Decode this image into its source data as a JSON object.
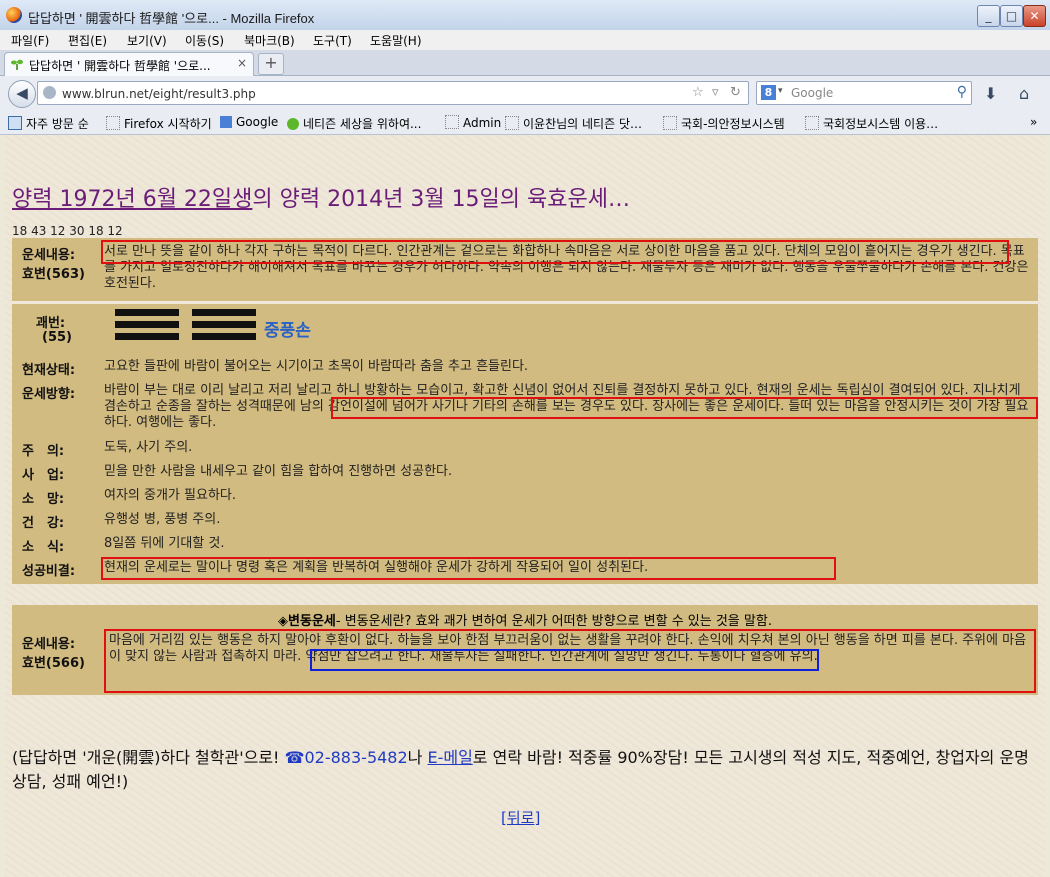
{
  "window": {
    "title": "답답하면 ' 開雲하다 哲學館 '으로... - Mozilla Firefox",
    "min": "_",
    "max": "□",
    "close": "✕"
  },
  "menu": [
    "파일(F)",
    "편집(E)",
    "보기(V)",
    "이동(S)",
    "북마크(B)",
    "도구(T)",
    "도움말(H)"
  ],
  "tab": {
    "label": "답답하면 ' 開雲하다 哲學館 '으로...",
    "close": "×",
    "new": "+"
  },
  "nav": {
    "url": "www.blrun.net/eight/result3.php",
    "search_placeholder": "Google",
    "search_engine": "8"
  },
  "bookmarks": [
    "자주 방문 순",
    "Firefox 시작하기",
    "Google",
    "네티즌 세상을 위하여...",
    "Admin",
    "이윤찬님의 네티즌 닷…",
    "국회-의안정보시스템",
    "국회정보시스템 이용…"
  ],
  "page": {
    "heading_link": "양력 1972년 6월 22일생",
    "heading_rest": "의 양력 2014년 3월 15일의 육효운세…",
    "codes": "18 43 12 30 18 12",
    "fortune": {
      "label1": "운세내용:",
      "label2": "효변(563)",
      "text": "서로 만나 뜻을 같이 하나 각자 구하는 목적이 다르다. 인간관계는 겉으로는 화합하나 속마음은 서로 상이한 마음을 품고 있다. 단체의 모임이 흩어지는 경우가 생긴다. 목표를 가지고 일로정진하다가 해이해져서 목표를 바꾸는 경우가 허다하다. 약속의 이행은 되지 않는다. 재물투자 등은 재미가 없다. 행동을 우물쭈물하다가 손해를 본다. 건강은 호전된다."
    },
    "hexagram": {
      "label1": "괘번:",
      "label2": "(55)",
      "name": "중풍손"
    },
    "details": [
      {
        "label": "현재상태:",
        "text": "고요한 들판에 바람이 불어오는 시기이고 초목이 바람따라 춤을 추고 흔들린다."
      },
      {
        "label": "운세방향:",
        "text": "바람이 부는 대로 이리 날리고 저리 날리고 하니 방황하는 모습이고, 확고한 신념이 없어서 진퇴를 결정하지 못하고 있다. 현재의 운세는 독립심이 결여되어 있다. 지나치게 겸손하고 순종을 잘하는 성격때문에 남의 감언이설에 넘어가 사기나 기타의 손해를 보는 경우도 있다. 장사에는 좋은 운세이다. 들떠 있는 마음을 안정시키는 것이 가장 필요하다. 여행에는 좋다."
      },
      {
        "label": "주　의:",
        "text": "도둑, 사기 주의."
      },
      {
        "label": "사　업:",
        "text": "믿을 만한 사람을 내세우고 같이 힘을 합하여 진행하면 성공한다."
      },
      {
        "label": "소　망:",
        "text": "여자의 중개가 필요하다."
      },
      {
        "label": "건　강:",
        "text": "유행성 병, 풍병 주의."
      },
      {
        "label": "소　식:",
        "text": "8일쯤 뒤에 기대할 것."
      },
      {
        "label": "성공비결:",
        "text": "현재의 운세로는 말이나 명령 혹은 계획을 반복하여 실행해야 운세가 강하게 작용되어 일이 성취된다."
      }
    ],
    "change": {
      "title": "◈변동운세",
      "subtitle": "- 변동운세란? 효와 괘가 변하여 운세가 어떠한 방향으로 변할 수 있는 것을 말함.",
      "label1": "운세내용:",
      "label2": "효변(566)",
      "text": "마음에 거리낌 있는 행동은 하지 말아야 후환이 없다. 하늘을 보아 한점 부끄러움이 없는 생활을 꾸려야 한다. 손익에 치우쳐 본의 아닌 행동을 하면 피를 본다. 주위에 마음이 맞지 않는 사람과 접촉하지 마라. 약점만 잡으려고 한다. 재물투자는 실패한다. 인간관계에 실망만 생긴다. 두통이나 혈증에 유의."
    },
    "footer": {
      "pre": "(답답하면 '개운(開雲)하다 철학관'으로! ",
      "phone": "☎02-883-5482",
      "mid": "나 ",
      "email": "E-메일",
      "post": "로 연락 바람! 적중률 90%장담! 모든 고시생의 적성 지도, 적중예언, 창업자의 운명상담, 성패 예언!)"
    },
    "back": "[뒤로]"
  }
}
